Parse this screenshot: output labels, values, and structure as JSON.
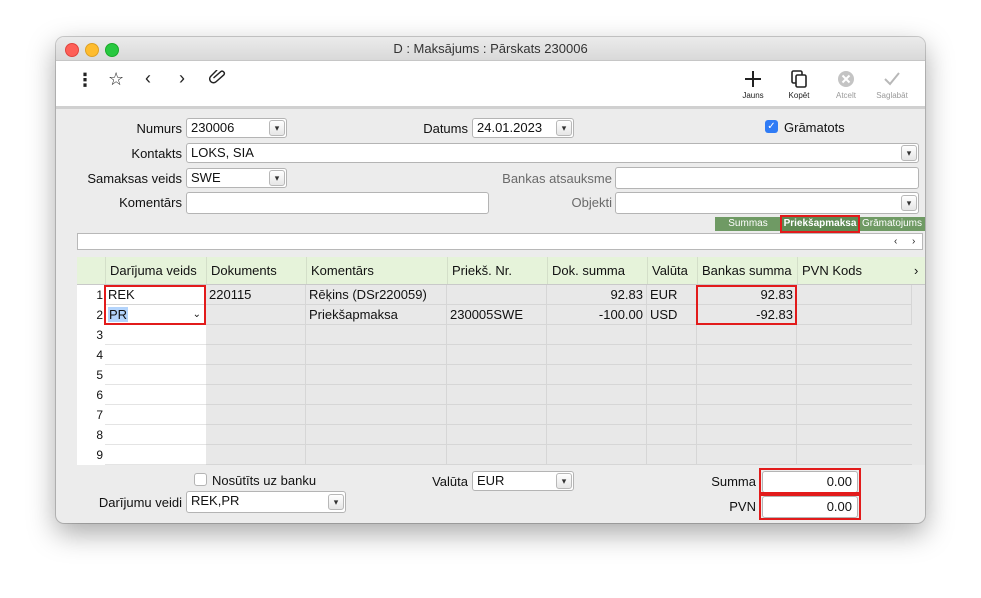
{
  "window": {
    "title": "D : Maksājums : Pārskats 230006"
  },
  "toolbar": {
    "left_icons": [
      "more-vertical-icon",
      "star-icon",
      "chevron-left-icon",
      "chevron-right-icon",
      "paperclip-icon"
    ],
    "new_label": "Jauns",
    "copy_label": "Kopēt",
    "cancel_label": "Atcelt",
    "save_label": "Saglabāt"
  },
  "form": {
    "numurs_label": "Numurs",
    "numurs_value": "230006",
    "datums_label": "Datums",
    "datums_value": "24.01.2023",
    "gramatots_label": "Grāmatots",
    "gramatots_checked": true,
    "kontakts_label": "Kontakts",
    "kontakts_value": "LOKS, SIA",
    "samaksas_label": "Samaksas veids",
    "samaksas_value": "SWE",
    "bankas_label": "Bankas atsauksme",
    "bankas_value": "",
    "komentars_label": "Komentārs",
    "komentars_value": "",
    "objekti_label": "Objekti",
    "objekti_value": ""
  },
  "tabs": {
    "summas": "Summas",
    "priekssapmaksa": "Priekšapmaksa",
    "gramatojums": "Grāmatojums"
  },
  "grid": {
    "columns": [
      "Darījuma veids",
      "Dokuments",
      "Komentārs",
      "Priekš. Nr.",
      "Dok. summa",
      "Valūta",
      "Bankas summa",
      "PVN Kods"
    ],
    "row_numbers": [
      "1",
      "2",
      "3",
      "4",
      "5",
      "6",
      "7",
      "8",
      "9"
    ],
    "rows": [
      [
        "REK",
        "220115",
        "Rēķins (DSr220059)",
        "",
        "92.83",
        "EUR",
        "92.83",
        ""
      ],
      [
        "PR",
        "",
        "Priekšapmaksa",
        "230005SWE",
        "-100.00",
        "USD",
        "-92.83",
        ""
      ]
    ]
  },
  "bottom": {
    "nosutits_label": "Nosūtīts uz banku",
    "nosutits_checked": false,
    "valuta_label": "Valūta",
    "valuta_value": "EUR",
    "veidi_label": "Darījumu veidi",
    "veidi_value": "REK,PR",
    "summa_label": "Summa",
    "summa_value": "0.00",
    "pvn_label": "PVN",
    "pvn_value": "0.00"
  },
  "colors": {
    "accent": "#2f7bf5",
    "highlight": "#e21b1b",
    "tab_green": "#6f9a64",
    "header_bg": "#e6f3da"
  }
}
